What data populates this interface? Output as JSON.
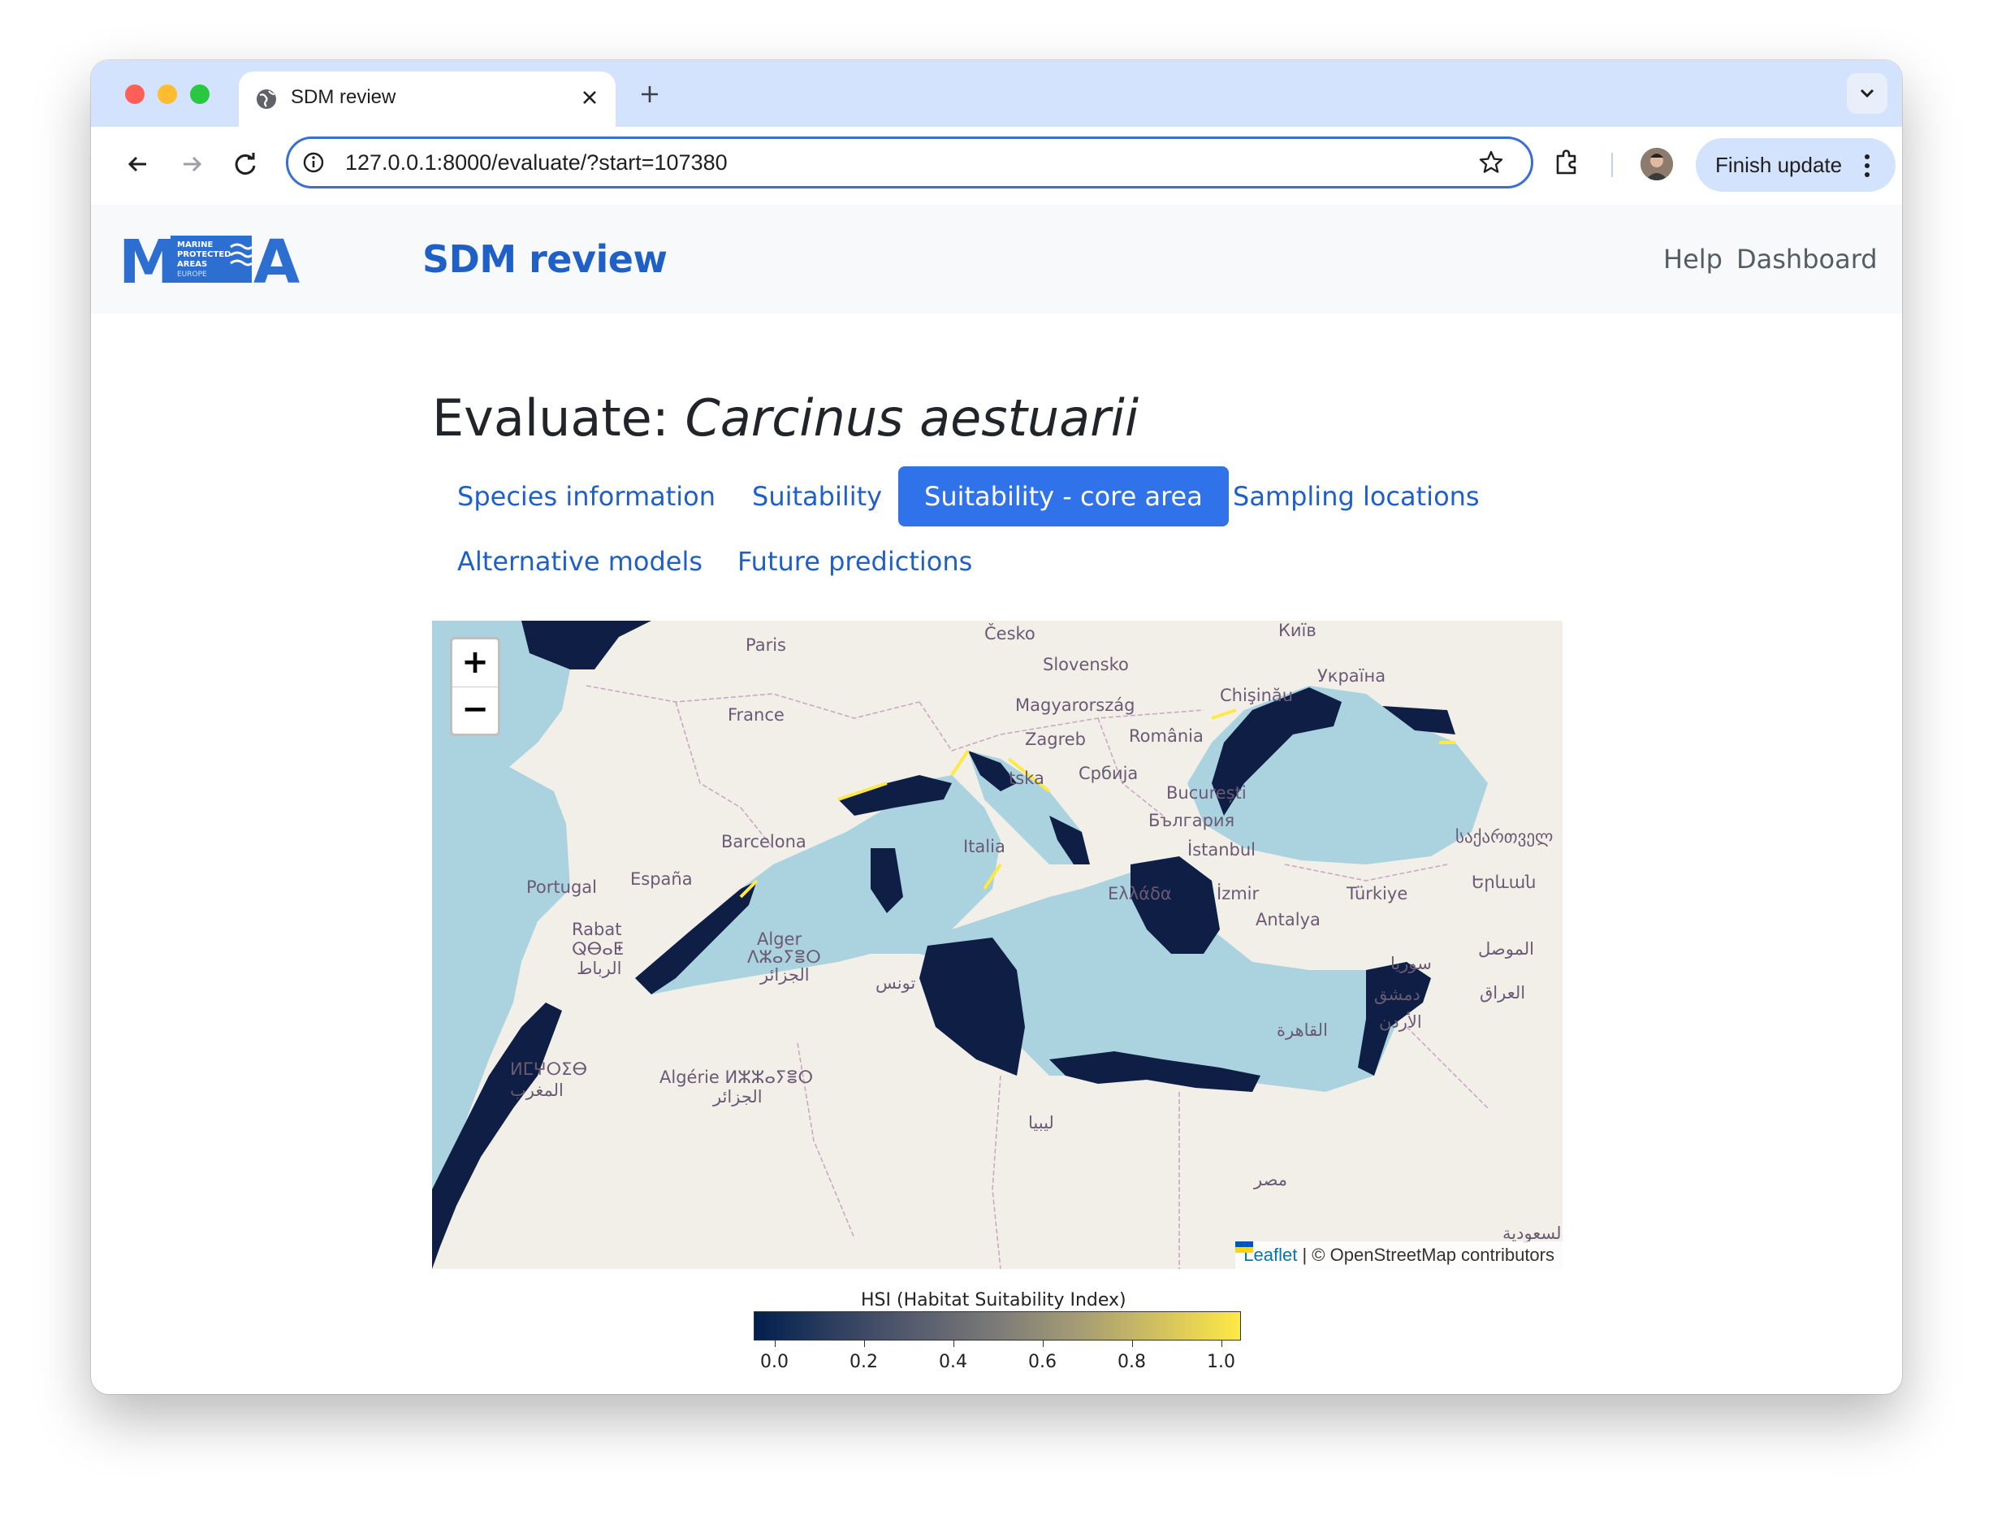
{
  "browser": {
    "tab_title": "SDM review",
    "url": "127.0.0.1:8000/evaluate/?start=107380",
    "finish_update_label": "Finish update"
  },
  "site": {
    "logo_text": "MPA",
    "logo_sub": [
      "MARINE",
      "PROTECTED",
      "AREAS",
      "EUROPE"
    ],
    "brand": "SDM review",
    "nav": [
      "Help",
      "Dashboard"
    ]
  },
  "page": {
    "heading_prefix": "Evaluate:",
    "species": "Carcinus aestuarii",
    "tabs": [
      {
        "label": "Species information",
        "active": false
      },
      {
        "label": "Suitability",
        "active": false
      },
      {
        "label": "Suitability - core area",
        "active": true
      },
      {
        "label": "Sampling locations",
        "active": false
      },
      {
        "label": "Alternative models",
        "active": false
      },
      {
        "label": "Future predictions",
        "active": false
      }
    ]
  },
  "map": {
    "zoom_in": "+",
    "zoom_out": "−",
    "attribution_link": "Leaflet",
    "attribution_rest": "| © OpenStreetMap contributors",
    "labels": {
      "paris": "Paris",
      "france": "France",
      "cesko": "Česko",
      "slovensko": "Slovensko",
      "kyiv": "Київ",
      "ukraina": "Україна",
      "chisinau": "Chişinău",
      "magyar": "Magyarország",
      "zagreb": "Zagreb",
      "romania": "România",
      "srbija": "Србија",
      "bucuresti": "București",
      "bulgaria": "България",
      "hrvatska": "tska",
      "barcelona": "Barcelona",
      "italia": "Italia",
      "istanbul": "İstanbul",
      "georgia": "საქართველ",
      "yerevan": "Երևան",
      "portugal": "Portugal",
      "espana": "España",
      "ellada": "Ελλάδα",
      "izmir": "İzmir",
      "turkiye": "Türkiye",
      "antalya": "Antalya",
      "rabat": "Rabat",
      "rabat_tz": "ⵕⴱⴰⵟ",
      "rabat_ar": "الرباط",
      "alger": "Alger",
      "alger_tz": "ⴷⵣⴰⵢⴻⵔ",
      "alger_ar": "الجزائر",
      "tunis": "تونس",
      "mosul": "الموصل",
      "syria": "سوريا",
      "iraq": "العراق",
      "damascus": "دمشق",
      "jordan": "الأردن",
      "cairo": "القاهرة",
      "morocco_tz": "ⵍⵎⵖⵔⵉⴱ",
      "morocco_ar": "المغرب",
      "algerie": "Algérie ⵍⵣⵣⴰⵢⴻⵔ",
      "algerie_ar": "الجزائر",
      "libya": "ليبيا",
      "egypt": "مصر",
      "saudi": "السعودية"
    }
  },
  "legend": {
    "title": "HSI (Habitat Suitability Index)",
    "ticks": [
      "0.0",
      "0.2",
      "0.4",
      "0.6",
      "0.8",
      "1.0"
    ],
    "colors": {
      "low": "#00204d",
      "high": "#fde945"
    }
  }
}
